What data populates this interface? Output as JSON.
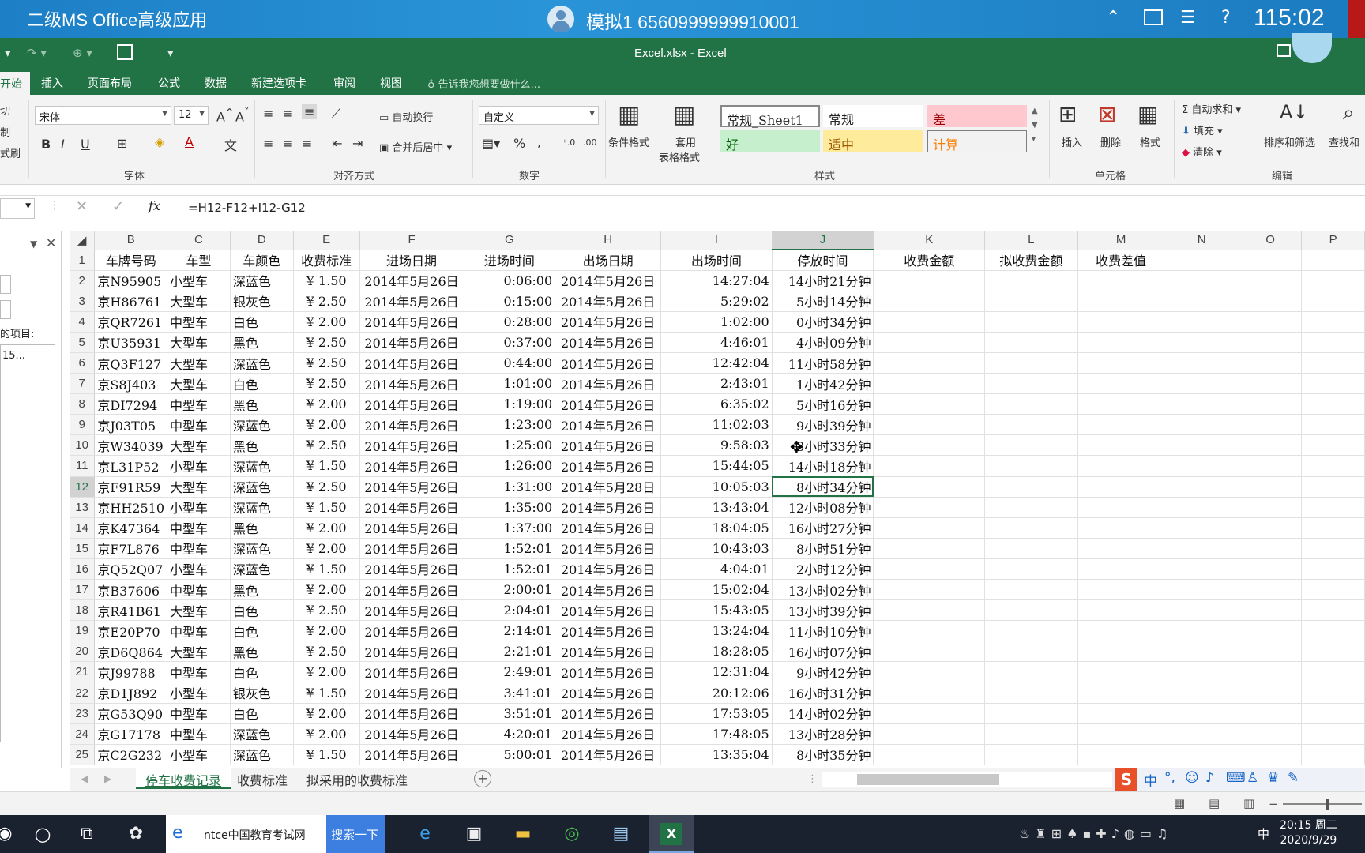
{
  "exam": {
    "title": "二级MS Office高级应用",
    "user": "模拟1  6560999999910001",
    "timer": "115:02"
  },
  "window": {
    "filename": "Excel.xlsx - Excel"
  },
  "tabs": [
    "开始",
    "插入",
    "页面布局",
    "公式",
    "数据",
    "新建选项卡",
    "审阅",
    "视图"
  ],
  "tell_me": "告诉我您想要做什么...",
  "ribbon": {
    "clipboard": {
      "cut": "切",
      "copy": "制",
      "format_painter": "式刷"
    },
    "font": {
      "name": "宋体",
      "size": "12",
      "group": "字体",
      "bold": "B",
      "italic": "I",
      "underline": "U"
    },
    "alignment": {
      "wrap": "自动换行",
      "merge": "合并后居中",
      "group": "对齐方式"
    },
    "number": {
      "format": "自定义",
      "group": "数字",
      "percent": "%",
      "comma": ","
    },
    "styles": {
      "conditional": "条件格式",
      "table_format_1": "套用",
      "table_format_2": "表格格式",
      "group": "样式",
      "cells": [
        "常规_Sheet1",
        "常规",
        "差",
        "好",
        "适中",
        "计算"
      ]
    },
    "cells": {
      "insert": "插入",
      "delete": "删除",
      "format": "格式",
      "group": "单元格"
    },
    "editing": {
      "autosum": "自动求和",
      "fill": "填充",
      "clear": "清除",
      "sort": "排序和筛选",
      "find": "查找和",
      "group": "编辑"
    }
  },
  "formula_bar": {
    "fx": "fx",
    "formula": "=H12-F12+I12-G12"
  },
  "left_pane": {
    "label": "的项目:",
    "item": "15..."
  },
  "grid": {
    "columns": [
      "B",
      "C",
      "D",
      "E",
      "F",
      "G",
      "H",
      "I",
      "J",
      "K",
      "L",
      "M",
      "N",
      "O",
      "P"
    ],
    "selected_column": "J",
    "selected_row": "12",
    "header_row": [
      "车牌号码",
      "车型",
      "车颜色",
      "收费标准",
      "进场日期",
      "进场时间",
      "出场日期",
      "出场时间",
      "停放时间",
      "收费金额",
      "拟收费金额",
      "收费差值",
      "",
      "",
      ""
    ],
    "rows": [
      [
        "2",
        "京N95905",
        "小型车",
        "深蓝色",
        "¥ 1.50",
        "2014年5月26日",
        "0:06:00",
        "2014年5月26日",
        "14:27:04",
        "14小时21分钟"
      ],
      [
        "3",
        "京H86761",
        "大型车",
        "银灰色",
        "¥ 2.50",
        "2014年5月26日",
        "0:15:00",
        "2014年5月26日",
        "5:29:02",
        "5小时14分钟"
      ],
      [
        "4",
        "京QR7261",
        "中型车",
        "白色",
        "¥ 2.00",
        "2014年5月26日",
        "0:28:00",
        "2014年5月26日",
        "1:02:00",
        "0小时34分钟"
      ],
      [
        "5",
        "京U35931",
        "大型车",
        "黑色",
        "¥ 2.50",
        "2014年5月26日",
        "0:37:00",
        "2014年5月26日",
        "4:46:01",
        "4小时09分钟"
      ],
      [
        "6",
        "京Q3F127",
        "大型车",
        "深蓝色",
        "¥ 2.50",
        "2014年5月26日",
        "0:44:00",
        "2014年5月26日",
        "12:42:04",
        "11小时58分钟"
      ],
      [
        "7",
        "京S8J403",
        "大型车",
        "白色",
        "¥ 2.50",
        "2014年5月26日",
        "1:01:00",
        "2014年5月26日",
        "2:43:01",
        "1小时42分钟"
      ],
      [
        "8",
        "京DI7294",
        "中型车",
        "黑色",
        "¥ 2.00",
        "2014年5月26日",
        "1:19:00",
        "2014年5月26日",
        "6:35:02",
        "5小时16分钟"
      ],
      [
        "9",
        "京J03T05",
        "中型车",
        "深蓝色",
        "¥ 2.00",
        "2014年5月26日",
        "1:23:00",
        "2014年5月26日",
        "11:02:03",
        "9小时39分钟"
      ],
      [
        "10",
        "京W34039",
        "大型车",
        "黑色",
        "¥ 2.50",
        "2014年5月26日",
        "1:25:00",
        "2014年5月26日",
        "9:58:03",
        "8小时33分钟"
      ],
      [
        "11",
        "京L31P52",
        "小型车",
        "深蓝色",
        "¥ 1.50",
        "2014年5月26日",
        "1:26:00",
        "2014年5月26日",
        "15:44:05",
        "14小时18分钟"
      ],
      [
        "12",
        "京F91R59",
        "大型车",
        "深蓝色",
        "¥ 2.50",
        "2014年5月26日",
        "1:31:00",
        "2014年5月28日",
        "10:05:03",
        "8小时34分钟"
      ],
      [
        "13",
        "京HH2510",
        "小型车",
        "深蓝色",
        "¥ 1.50",
        "2014年5月26日",
        "1:35:00",
        "2014年5月26日",
        "13:43:04",
        "12小时08分钟"
      ],
      [
        "14",
        "京K47364",
        "中型车",
        "黑色",
        "¥ 2.00",
        "2014年5月26日",
        "1:37:00",
        "2014年5月26日",
        "18:04:05",
        "16小时27分钟"
      ],
      [
        "15",
        "京F7L876",
        "中型车",
        "深蓝色",
        "¥ 2.00",
        "2014年5月26日",
        "1:52:01",
        "2014年5月26日",
        "10:43:03",
        "8小时51分钟"
      ],
      [
        "16",
        "京Q52Q07",
        "小型车",
        "深蓝色",
        "¥ 1.50",
        "2014年5月26日",
        "1:52:01",
        "2014年5月26日",
        "4:04:01",
        "2小时12分钟"
      ],
      [
        "17",
        "京B37606",
        "中型车",
        "黑色",
        "¥ 2.00",
        "2014年5月26日",
        "2:00:01",
        "2014年5月26日",
        "15:02:04",
        "13小时02分钟"
      ],
      [
        "18",
        "京R41B61",
        "大型车",
        "白色",
        "¥ 2.50",
        "2014年5月26日",
        "2:04:01",
        "2014年5月26日",
        "15:43:05",
        "13小时39分钟"
      ],
      [
        "19",
        "京E20P70",
        "中型车",
        "白色",
        "¥ 2.00",
        "2014年5月26日",
        "2:14:01",
        "2014年5月26日",
        "13:24:04",
        "11小时10分钟"
      ],
      [
        "20",
        "京D6Q864",
        "大型车",
        "黑色",
        "¥ 2.50",
        "2014年5月26日",
        "2:21:01",
        "2014年5月26日",
        "18:28:05",
        "16小时07分钟"
      ],
      [
        "21",
        "京J99788",
        "中型车",
        "白色",
        "¥ 2.00",
        "2014年5月26日",
        "2:49:01",
        "2014年5月26日",
        "12:31:04",
        "9小时42分钟"
      ],
      [
        "22",
        "京D1J892",
        "小型车",
        "银灰色",
        "¥ 1.50",
        "2014年5月26日",
        "3:41:01",
        "2014年5月26日",
        "20:12:06",
        "16小时31分钟"
      ],
      [
        "23",
        "京G53Q90",
        "中型车",
        "白色",
        "¥ 2.00",
        "2014年5月26日",
        "3:51:01",
        "2014年5月26日",
        "17:53:05",
        "14小时02分钟"
      ],
      [
        "24",
        "京G17178",
        "中型车",
        "深蓝色",
        "¥ 2.00",
        "2014年5月26日",
        "4:20:01",
        "2014年5月26日",
        "17:48:05",
        "13小时28分钟"
      ],
      [
        "25",
        "京C2G232",
        "小型车",
        "深蓝色",
        "¥ 1.50",
        "2014年5月26日",
        "5:00:01",
        "2014年5月26日",
        "13:35:04",
        "8小时35分钟"
      ]
    ]
  },
  "sheets": [
    "停车收费记录",
    "收费标准",
    "拟采用的收费标准"
  ],
  "taskbar": {
    "search_text": "ntce中国教育考试网",
    "search_button": "搜索一下",
    "ime": "中",
    "time": "20:15 周二",
    "date": "2020/9/29"
  },
  "colors": {
    "excel_green": "#217346",
    "exam_blue": "#1d7fc6"
  }
}
